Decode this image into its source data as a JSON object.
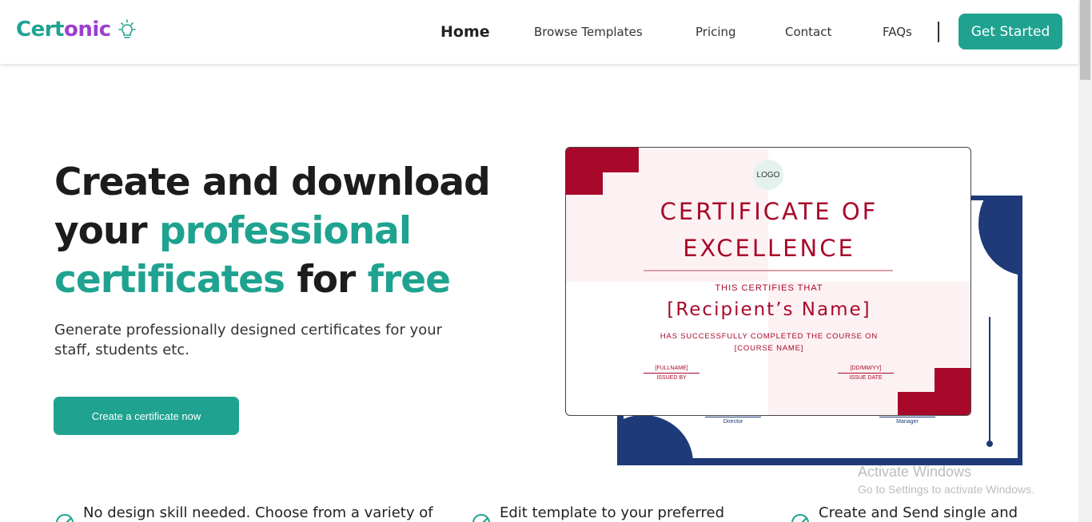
{
  "brand": {
    "part1": "Cert",
    "part2": "onic",
    "icon": "lightbulb-icon"
  },
  "nav": {
    "home": "Home",
    "browse": "Browse Templates",
    "pricing": "Pricing",
    "contact": "Contact",
    "faqs": "FAQs",
    "cta": "Get Started"
  },
  "hero": {
    "line1": "Create and download",
    "line2a": "your ",
    "line2b": "professional",
    "line3a": "certificates",
    "line3b": " for ",
    "line3c": "free",
    "subtitle": "Generate professionally designed certificates for your staff, students etc.",
    "cta": "Create a certificate now"
  },
  "certificate": {
    "logo": "LOGO",
    "title_line1": "CERTIFICATE OF",
    "title_line2": "EXCELLENCE",
    "certifies": "THIS CERTIFIES THAT",
    "recipient": "[Recipient’s Name]",
    "completed": "HAS SUCCESSFULLY COMPLETED THE COURSE ON",
    "course": "[COURSE NAME]",
    "sig_left_value": "[FULLNAME]",
    "sig_left_caption": "ISSUED BY",
    "sig_right_value": "[DD/MM/YY]",
    "sig_right_caption": "ISSUE DATE",
    "back_sig_left": "Director",
    "back_sig_right": "Manager"
  },
  "features": [
    {
      "text": "No design skill needed. Choose from a variety of",
      "icon": "check-circle-icon"
    },
    {
      "text": "Edit template to your preferred",
      "icon": "check-circle-icon"
    },
    {
      "text": "Create and Send single and",
      "icon": "check-circle-icon"
    }
  ],
  "watermark": {
    "title": "Activate Windows",
    "subtitle": "Go to Settings to activate Windows."
  },
  "colors": {
    "accent": "#1fa390",
    "brand_purple": "#9b3fd1",
    "cert_red": "#a8082a",
    "cert_navy": "#1e3a78"
  }
}
